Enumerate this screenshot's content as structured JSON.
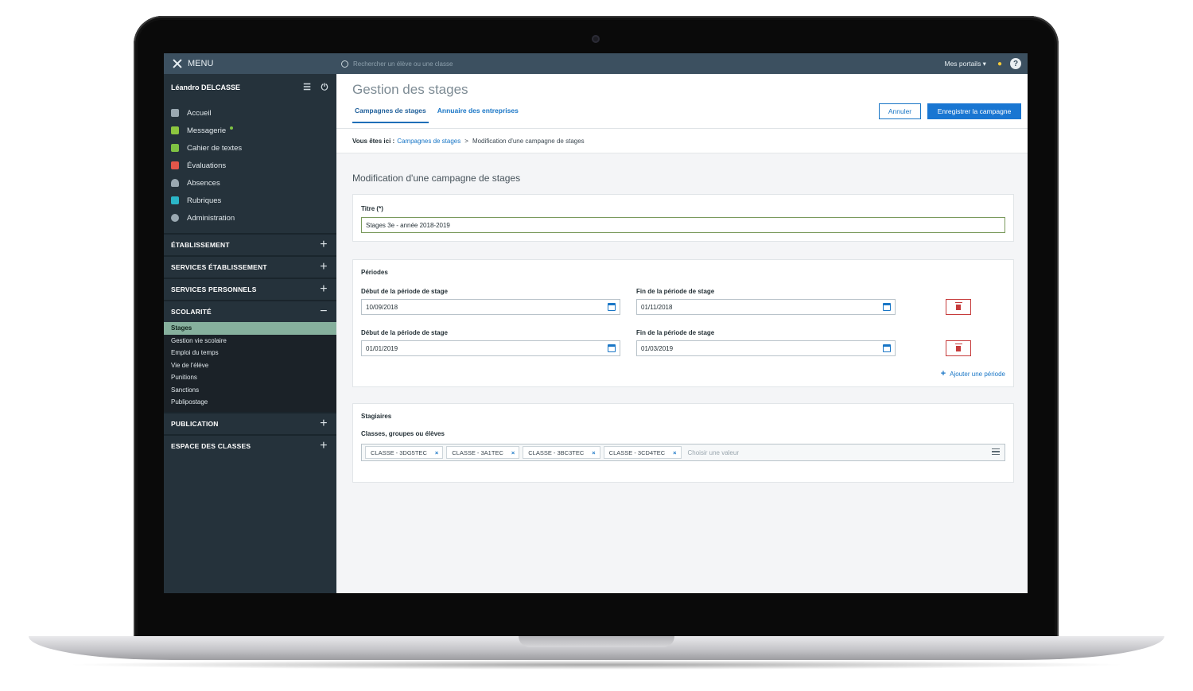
{
  "sidebar": {
    "menu_label": "MENU",
    "user_name": "Léandro DELCASSE",
    "nav": [
      {
        "label": "Accueil",
        "icon": "grid-icon",
        "color": "#9aa8b1"
      },
      {
        "label": "Messagerie",
        "icon": "mail-icon",
        "color": "#8dc63f",
        "unread": true
      },
      {
        "label": "Cahier de textes",
        "icon": "notebook-icon",
        "color": "#7fc243"
      },
      {
        "label": "Évaluations",
        "icon": "evaluation-icon",
        "color": "#e0564a"
      },
      {
        "label": "Absences",
        "icon": "person-icon",
        "color": "#9aa8b1"
      },
      {
        "label": "Rubriques",
        "icon": "comment-icon",
        "color": "#2bb6c8"
      },
      {
        "label": "Administration",
        "icon": "gear-icon",
        "color": "#9aa8b1"
      }
    ],
    "sections": {
      "etablissement": "ÉTABLISSEMENT",
      "services_etablissement": "SERVICES ÉTABLISSEMENT",
      "services_personnels": "SERVICES PERSONNELS",
      "scolarite": "SCOLARITÉ",
      "publication": "PUBLICATION",
      "espace_classes": "ESPACE DES CLASSES"
    },
    "scolarite_items": [
      "Stages",
      "Gestion vie scolaire",
      "Emploi du temps",
      "Vie de l'élève",
      "Punitions",
      "Sanctions",
      "Publipostage"
    ],
    "active_item": "Stages"
  },
  "topbar": {
    "search_placeholder": "Rechercher un élève ou une classe",
    "portals_label": "Mes portails ▾",
    "help_label": "?"
  },
  "header": {
    "title": "Gestion des stages",
    "tabs": [
      "Campagnes de stages",
      "Annuaire des entreprises"
    ],
    "active_tab": "Campagnes de stages",
    "cancel_label": "Annuler",
    "save_label": "Enregistrer la campagne"
  },
  "breadcrumb": {
    "prefix": "Vous êtes ici :",
    "link": "Campagnes de stages",
    "separator": ">",
    "current": "Modification d'une campagne de stages"
  },
  "form": {
    "heading": "Modification d'une campagne de stages",
    "title_label": "Titre (*)",
    "title_value": "Stages 3e - année 2018-2019",
    "periods_label": "Périodes",
    "periods": [
      {
        "start_label": "Début de la période de stage",
        "start": "10/09/2018",
        "end_label": "Fin de la période de stage",
        "end": "01/11/2018"
      },
      {
        "start_label": "Début de la période de stage",
        "start": "01/01/2019",
        "end_label": "Fin de la période de stage",
        "end": "01/03/2019"
      }
    ],
    "add_period_label": "Ajouter une période",
    "trainees_label": "Stagiaires",
    "groups_label": "Classes, groupes ou élèves",
    "tags": [
      "CLASSE - 3DG5TEC",
      "CLASSE - 3A1TEC",
      "CLASSE - 3BC3TEC",
      "CLASSE - 3CD4TEC"
    ],
    "tags_placeholder": "Choisir une valeur"
  },
  "colors": {
    "accent": "#1976d2",
    "sidebar": "#25323b",
    "topbar": "#3c5060",
    "active_item": "#86b09d",
    "danger": "#c63b3b"
  }
}
